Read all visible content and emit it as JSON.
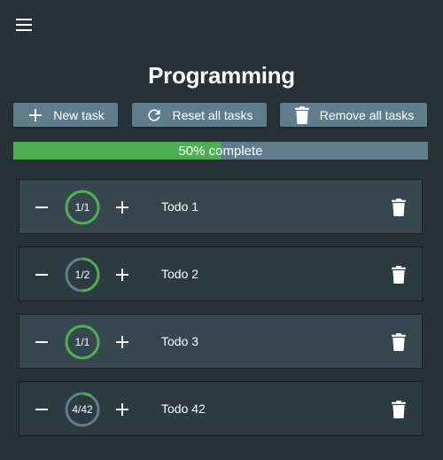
{
  "header": {
    "title": "Programming",
    "menu_icon": "hamburger-menu-icon"
  },
  "actions": {
    "new_task": "New task",
    "reset_all": "Reset all tasks",
    "remove_all": "Remove all tasks"
  },
  "progress": {
    "label": "50% complete",
    "fraction": 0.5
  },
  "colors": {
    "accent": "#4caf50",
    "track": "#607d8b",
    "background": "#263238"
  },
  "tasks": [
    {
      "name": "Todo 1",
      "count": "1/1",
      "done": 1,
      "total": 1
    },
    {
      "name": "Todo 2",
      "count": "1/2",
      "done": 1,
      "total": 2
    },
    {
      "name": "Todo 3",
      "count": "1/1",
      "done": 1,
      "total": 1
    },
    {
      "name": "Todo 42",
      "count": "4/42",
      "done": 4,
      "total": 42
    }
  ]
}
